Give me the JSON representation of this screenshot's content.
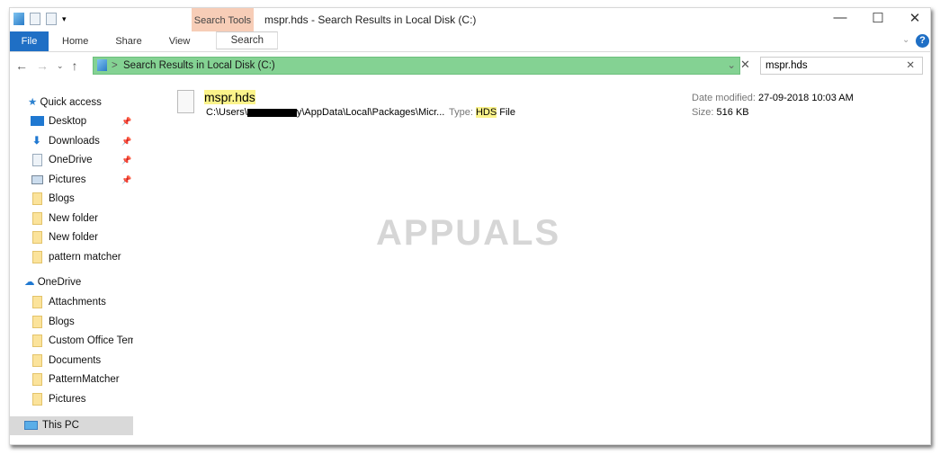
{
  "window": {
    "title": "mspr.hds - Search Results in Local Disk (C:)",
    "context_tab": "Search Tools"
  },
  "ribbon": {
    "tabs": [
      "File",
      "Home",
      "Share",
      "View",
      "Search"
    ]
  },
  "address": {
    "path": "Search Results in Local Disk (C:)",
    "separator": ">"
  },
  "search": {
    "value": "mspr.hds"
  },
  "sidebar": {
    "quick_access": "Quick access",
    "quick_items": [
      {
        "label": "Desktop",
        "icon": "desktop-icon",
        "pinned": true
      },
      {
        "label": "Downloads",
        "icon": "download-icon",
        "pinned": true
      },
      {
        "label": "OneDrive",
        "icon": "document-icon",
        "pinned": true
      },
      {
        "label": "Pictures",
        "icon": "pictures-icon",
        "pinned": true
      },
      {
        "label": "Blogs",
        "icon": "folder-icon"
      },
      {
        "label": "New folder",
        "icon": "folder-icon"
      },
      {
        "label": "New folder",
        "icon": "folder-icon"
      },
      {
        "label": "pattern matcher",
        "icon": "folder-icon"
      }
    ],
    "onedrive": "OneDrive",
    "onedrive_items": [
      "Attachments",
      "Blogs",
      "Custom Office Tem",
      "Documents",
      "PatternMatcher",
      "Pictures"
    ],
    "this_pc": "This PC"
  },
  "result": {
    "name": "mspr.hds",
    "path_prefix": "C:\\Users\\",
    "path_suffix": "y\\AppData\\Local\\Packages\\Micr...",
    "type_label": "Type:",
    "type_highlight": "HDS",
    "type_rest": " File",
    "date_label": "Date modified:",
    "date": "27-09-2018 10:03 AM",
    "size_label": "Size:",
    "size": "516 KB"
  },
  "watermark": "APPUALS",
  "colors": {
    "file_tab": "#1f6fc5",
    "address_highlight": "#84d293",
    "search_tools": "#f7cdb7",
    "match_highlight": "#fbf38a"
  }
}
